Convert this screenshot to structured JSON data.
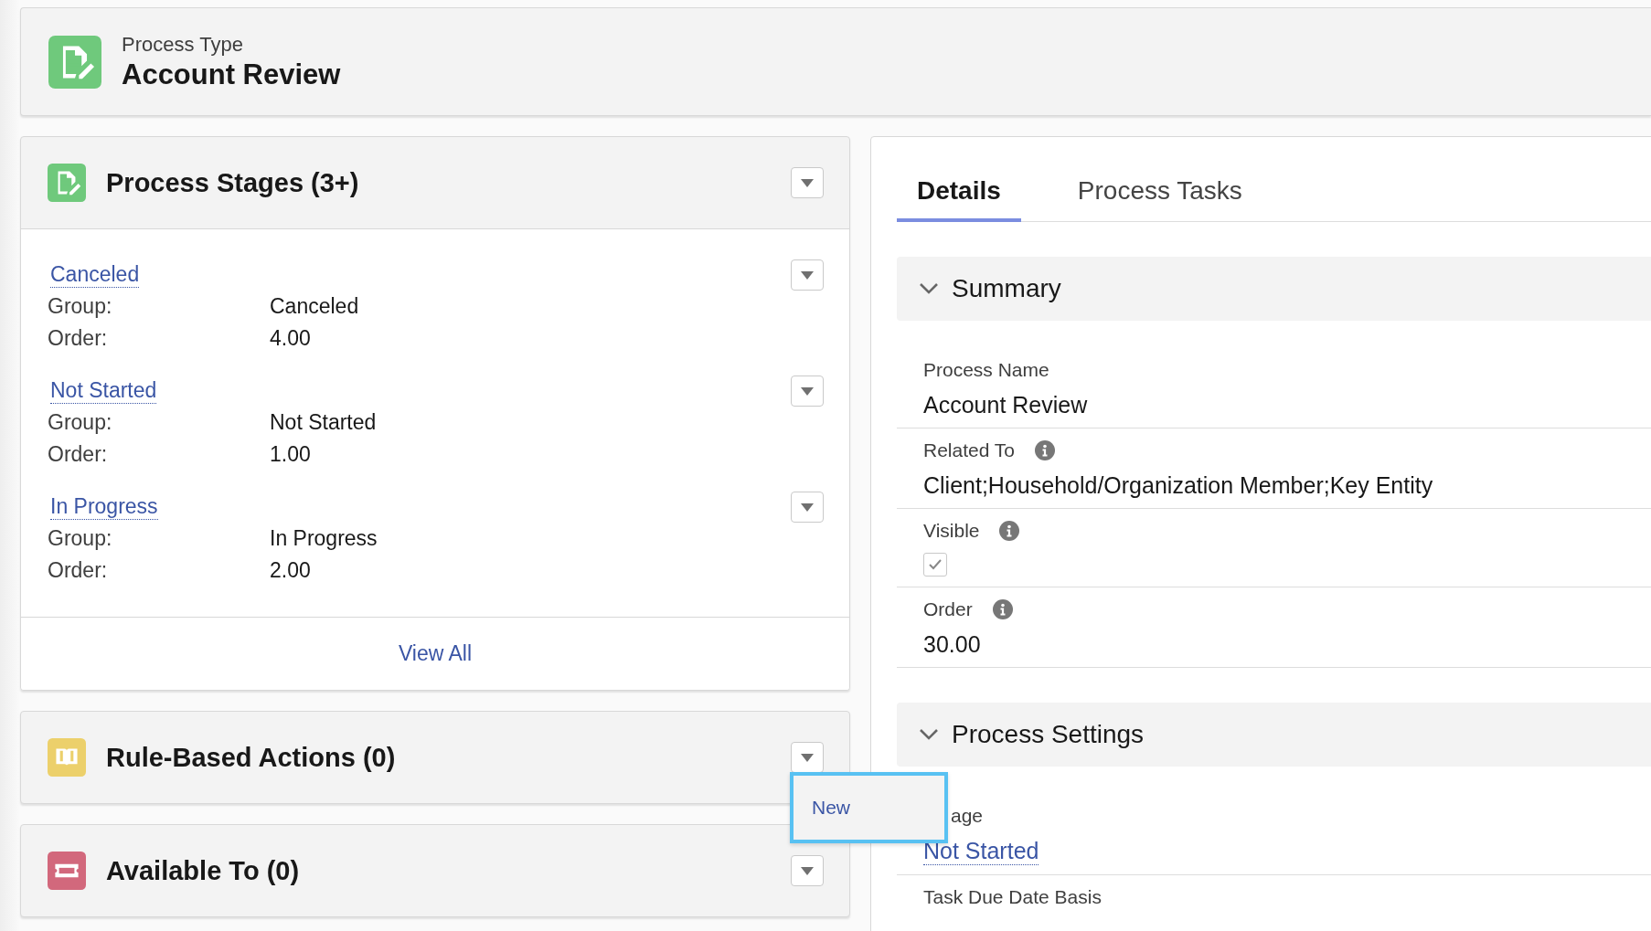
{
  "header": {
    "subtitle": "Process Type",
    "title": "Account Review"
  },
  "related_lists": [
    {
      "title": "Process Stages (3+)",
      "records": [
        {
          "name": "Canceled",
          "fields": [
            {
              "label": "Group:",
              "value": "Canceled"
            },
            {
              "label": "Order:",
              "value": "4.00"
            }
          ]
        },
        {
          "name": "Not Started",
          "fields": [
            {
              "label": "Group:",
              "value": "Not Started"
            },
            {
              "label": "Order:",
              "value": "1.00"
            }
          ]
        },
        {
          "name": "In Progress",
          "fields": [
            {
              "label": "Group:",
              "value": "In Progress"
            },
            {
              "label": "Order:",
              "value": "2.00"
            }
          ]
        }
      ],
      "footer_link": "View All"
    },
    {
      "title": "Rule-Based Actions (0)"
    },
    {
      "title": "Available To (0)"
    }
  ],
  "dropdown_menu": {
    "items": [
      "New"
    ]
  },
  "tabs": [
    {
      "label": "Details",
      "selected": true
    },
    {
      "label": "Process Tasks",
      "selected": false
    }
  ],
  "sections": [
    {
      "title": "Summary",
      "expanded": true,
      "fields": [
        {
          "label": "Process Name",
          "info": false,
          "kind": "text",
          "value": "Account Review"
        },
        {
          "label": "Related To",
          "info": true,
          "kind": "text",
          "value": "Client;Household/Organization Member;Key Entity"
        },
        {
          "label": "Visible",
          "info": true,
          "kind": "checkbox",
          "checked": true
        },
        {
          "label": "Order",
          "info": true,
          "kind": "text",
          "value": "30.00"
        }
      ]
    },
    {
      "title": "Process Settings",
      "expanded": true,
      "fields": [
        {
          "label": "age",
          "info": false,
          "covered": true,
          "kind": "link",
          "value": "Not Started"
        },
        {
          "label": "Task Due Date Basis",
          "info": false,
          "kind": "label_only"
        }
      ]
    }
  ]
}
